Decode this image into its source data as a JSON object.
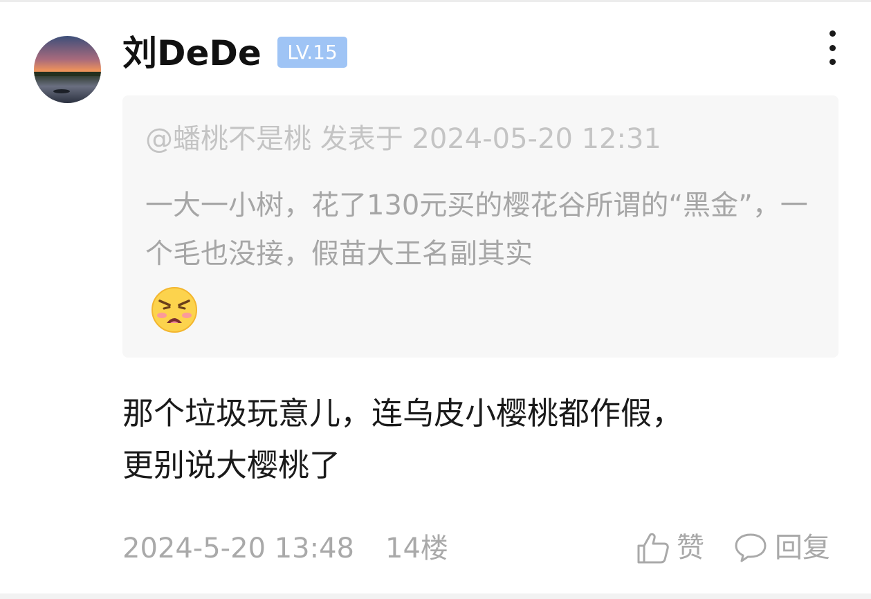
{
  "comment": {
    "author": "刘DeDe",
    "level_badge": "LV.15",
    "quote": {
      "meta": "@蟠桃不是桃 发表于 2024-05-20 12:31",
      "text": "一大一小树，花了130元买的樱花谷所谓的“黑金”，一个毛也没接，假苗大王名副其实",
      "emoji": "angry-face-emoji"
    },
    "reply_lines": [
      "那个垃圾玩意儿，连乌皮小樱桃都作假，",
      "更别说大樱桃了"
    ],
    "timestamp": "2024-5-20 13:48",
    "floor": "14楼",
    "actions": {
      "like_label": "赞",
      "reply_label": "回复"
    }
  },
  "colors": {
    "badge_bg": "#9fc4f5",
    "quote_bg": "#f7f7f7",
    "muted_text": "#a9a9a9"
  },
  "icons": [
    "more-vertical-icon",
    "thumbs-up-icon",
    "speech-bubble-icon"
  ]
}
